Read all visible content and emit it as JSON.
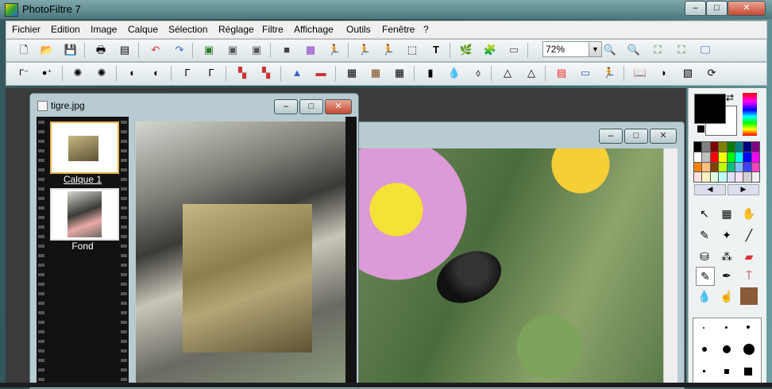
{
  "app": {
    "title": "PhotoFiltre 7"
  },
  "window_controls": {
    "minimize": "–",
    "maximize": "□",
    "close": "✕"
  },
  "menu": [
    "Fichier",
    "Edition",
    "Image",
    "Calque",
    "Sélection",
    "Réglage",
    "Filtre",
    "Affichage",
    "Outils",
    "Fenêtre",
    "?"
  ],
  "toolbar1": {
    "icons": [
      "new-file",
      "open-folder",
      "save-disk",
      "print",
      "scanner",
      "undo",
      "redo",
      "paste-layer",
      "copy-layer",
      "layer-image",
      "color-square",
      "color-grid",
      "clip-figure",
      "figure-left",
      "figure-right",
      "selection-rect",
      "text-T",
      "tree-icon",
      "puzzle-icon",
      "window-icon"
    ],
    "zoom": "72%"
  },
  "toolbar2": {
    "icons": [
      "gamma-auto",
      "gamma-auto-plus",
      "brightness-minus",
      "brightness-plus",
      "contrast-minus",
      "contrast-plus",
      "gamma-minus",
      "gamma-plus",
      "color-minus",
      "color-plus",
      "levels",
      "color-balance",
      "grid-dark",
      "grid-brown",
      "grid-black",
      "dropper",
      "drop",
      "drop-outline",
      "triangle",
      "triangle-outline",
      "gradient",
      "monitor",
      "figure",
      "book",
      "half-cylinder",
      "bucket",
      "rotate-tools"
    ]
  },
  "doc_front": {
    "title": "tigre.jpg",
    "layers": [
      {
        "label": "Calque 1",
        "selected": true
      },
      {
        "label": "Fond",
        "selected": false
      }
    ]
  },
  "doc_back": {
    "title": ""
  },
  "right_panel": {
    "palette": [
      "#000000",
      "#808080",
      "#800000",
      "#808000",
      "#008000",
      "#008080",
      "#000080",
      "#800080",
      "#ffffff",
      "#c0c0c0",
      "#ff0000",
      "#ffff00",
      "#00ff00",
      "#00ffff",
      "#0000ff",
      "#ff00ff",
      "#ff8000",
      "#ffc080",
      "#804000",
      "#c0ff00",
      "#00c080",
      "#80c0ff",
      "#4040ff",
      "#ff40c0",
      "#ffe0e0",
      "#fff0c0",
      "#e0ffe0",
      "#c0ffff",
      "#e0e0ff",
      "#ffe0ff",
      "#d0d0d0",
      "#f0f0f0"
    ],
    "prev": "◀",
    "next": "▶",
    "tools": [
      "pointer",
      "selection",
      "hand",
      "pipette",
      "magic-wand",
      "line",
      "bucket",
      "spray",
      "eraser",
      "brush",
      "pen-plus",
      "stamp",
      "drop",
      "finger",
      "portrait"
    ],
    "fg_color": "#000000",
    "bg_color": "#ffffff"
  }
}
